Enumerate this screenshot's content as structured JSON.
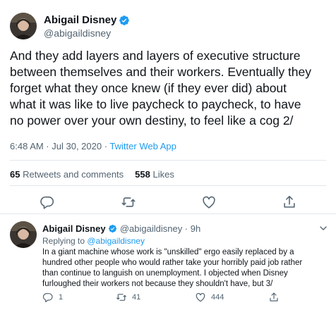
{
  "tweet": {
    "author": {
      "name": "Abigail Disney",
      "handle": "@abigaildisney",
      "verified": true
    },
    "text_lines": [
      "And they add layers and layers of executive structure",
      "between themselves and their workers.  Eventually they",
      "forget what they once knew (if they ever did) about",
      "what it was like to live paycheck to paycheck, to have",
      "no power over your own destiny, to feel like a cog 2/"
    ],
    "timestamp": "6:48 AM · Jul 30, 2020",
    "separator": " · ",
    "client": "Twitter Web App",
    "stats": {
      "retweets_count": "65",
      "retweets_label": "Retweets and comments",
      "likes_count": "558",
      "likes_label": "Likes"
    },
    "actions": [
      "reply-icon",
      "retweet-icon",
      "like-icon",
      "share-icon"
    ]
  },
  "reply": {
    "author": {
      "name": "Abigail Disney",
      "handle": "@abigaildisney",
      "verified": true
    },
    "time": " · 9h",
    "replying_prefix": "Replying to ",
    "replying_to": "@abigaildisney",
    "text_lines": [
      "In a giant machine whose work is \"unskilled\" ergo easily replaced by a",
      "hundred other people who would rather take your horribly paid job rather",
      "than continue to languish on unemployment.  I objected when Disney",
      "furloughed their workers not because they shouldn't have, but 3/"
    ],
    "counts": {
      "replies": "1",
      "retweets": "41",
      "likes": "444"
    }
  },
  "colors": {
    "accent": "#1d9bf0",
    "muted": "#536471",
    "divider": "#e1e8ed",
    "text": "#0f1419"
  }
}
